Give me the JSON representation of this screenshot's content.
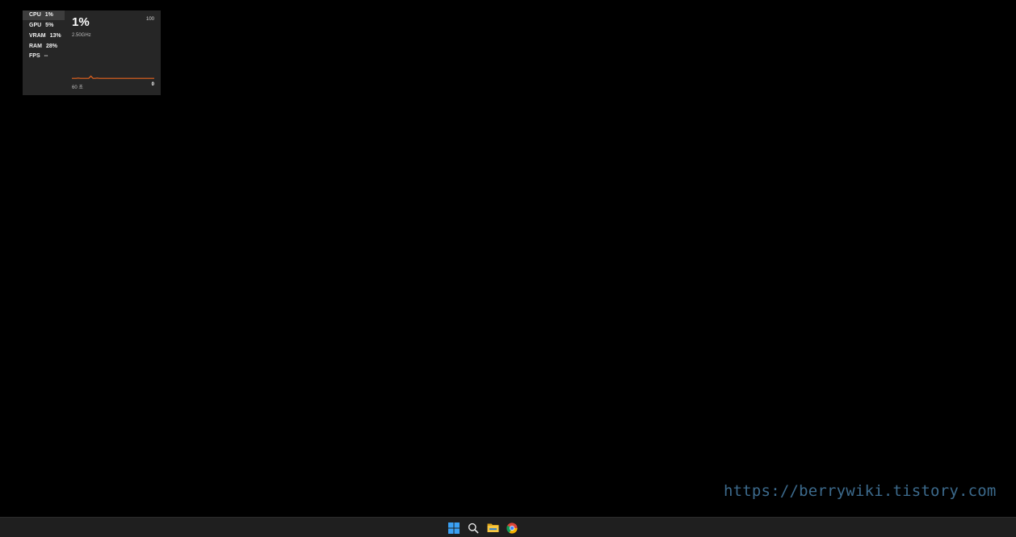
{
  "performance_overlay": {
    "metrics": [
      {
        "label": "CPU",
        "value": "1%"
      },
      {
        "label": "GPU",
        "value": "5%"
      },
      {
        "label": "VRAM",
        "value": "13%"
      },
      {
        "label": "RAM",
        "value": "28%"
      },
      {
        "label": "FPS",
        "value": "--"
      }
    ],
    "selected_metric": "CPU",
    "detail": {
      "big_value": "1%",
      "frequency": "2.50GHz",
      "scale_max": "100",
      "scale_min": "0",
      "time_window": "60 초"
    },
    "graph": {
      "line_color": "#e8641e",
      "y_max": 100,
      "values": [
        2,
        2,
        2,
        3,
        2,
        2,
        2,
        2,
        2,
        9,
        2,
        2,
        3,
        2,
        2,
        2,
        2,
        2,
        2,
        2,
        2,
        2,
        2,
        2,
        2,
        2,
        2,
        2,
        2,
        2,
        2,
        2,
        2,
        2,
        2,
        2,
        2,
        2,
        2,
        2
      ]
    }
  },
  "watermark": {
    "text": "https://berrywiki.tistory.com",
    "color": "#3c6a8c"
  },
  "taskbar": {
    "items": [
      {
        "name": "start-button",
        "icon": "windows-logo-icon"
      },
      {
        "name": "search-button",
        "icon": "search-icon"
      },
      {
        "name": "file-explorer-button",
        "icon": "folder-icon"
      },
      {
        "name": "chrome-button",
        "icon": "chrome-icon"
      }
    ],
    "accent_color": "#3aa0f3"
  }
}
